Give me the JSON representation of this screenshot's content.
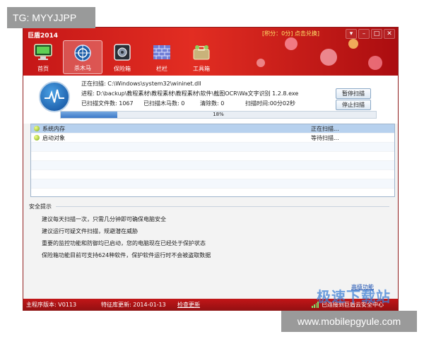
{
  "watermarks": {
    "top": "TG: MYYJJPP",
    "bottom": "www.mobilepgyule.com",
    "brand_overlay": "极速下载站"
  },
  "window": {
    "title": "巨盾2014",
    "score_link": "[积分：0分] 点击兑换]",
    "controls": [
      "▾",
      "–",
      "□",
      "✕"
    ]
  },
  "toolbar": {
    "items": [
      {
        "label": "首页",
        "icon": "monitor-icon",
        "active": false
      },
      {
        "label": "杀木马",
        "icon": "crosshair-icon",
        "active": true
      },
      {
        "label": "保险箱",
        "icon": "safe-icon",
        "active": false
      },
      {
        "label": "栏栏",
        "icon": "firewall-icon",
        "active": false
      },
      {
        "label": "工具箱",
        "icon": "toolbox-icon",
        "active": false
      }
    ]
  },
  "scan": {
    "current_label": "正在扫描:",
    "current_value": "C:\\Windows\\system32\\wininet.dll",
    "process_label": "进程:",
    "process_value": "D:\\backup\\教程素材\\教程素材\\教程素材\\软件\\截图OCR\\Wa文字识别 1.2.8.exe",
    "files_scanned": "已扫描文件数:  1067",
    "trojans_scanned": "已扫描木马数: 0",
    "cleaned": "清除数:  0",
    "elapsed": "扫描时间:00分02秒",
    "pause_button": "暂停扫描",
    "stop_button": "停止扫描",
    "progress_text": "18%",
    "progress_value": 18
  },
  "scan_list": {
    "rows": [
      {
        "name": "系统内存",
        "status": "正在扫描..."
      },
      {
        "name": "启动对象",
        "status": "等待扫描..."
      }
    ]
  },
  "tips": {
    "title": "安全提示",
    "items": [
      "建议每天扫描一次，只需几分钟即可确保电脑安全",
      "建议运行可疑文件扫描，规避潜在威胁",
      "重要的监控功能和防御均已启动，您的电脑现在已经处于保护状态",
      "保险箱功能目前可支持624种软件，保护软件运行时不会被盗取数据"
    ]
  },
  "advanced_link": "高级功能",
  "statusbar": {
    "version": "主程序版本:  V0113",
    "db_update": "特征库更新: 2014-01-13",
    "check_update": "检查更新",
    "cloud_status": "已连接到巨盾云安全中心"
  },
  "colors": {
    "header_red": "#c51717",
    "statusbar_red": "#c21618",
    "selection_blue": "#b7d1ee",
    "progress_blue": "#3a78c7"
  }
}
